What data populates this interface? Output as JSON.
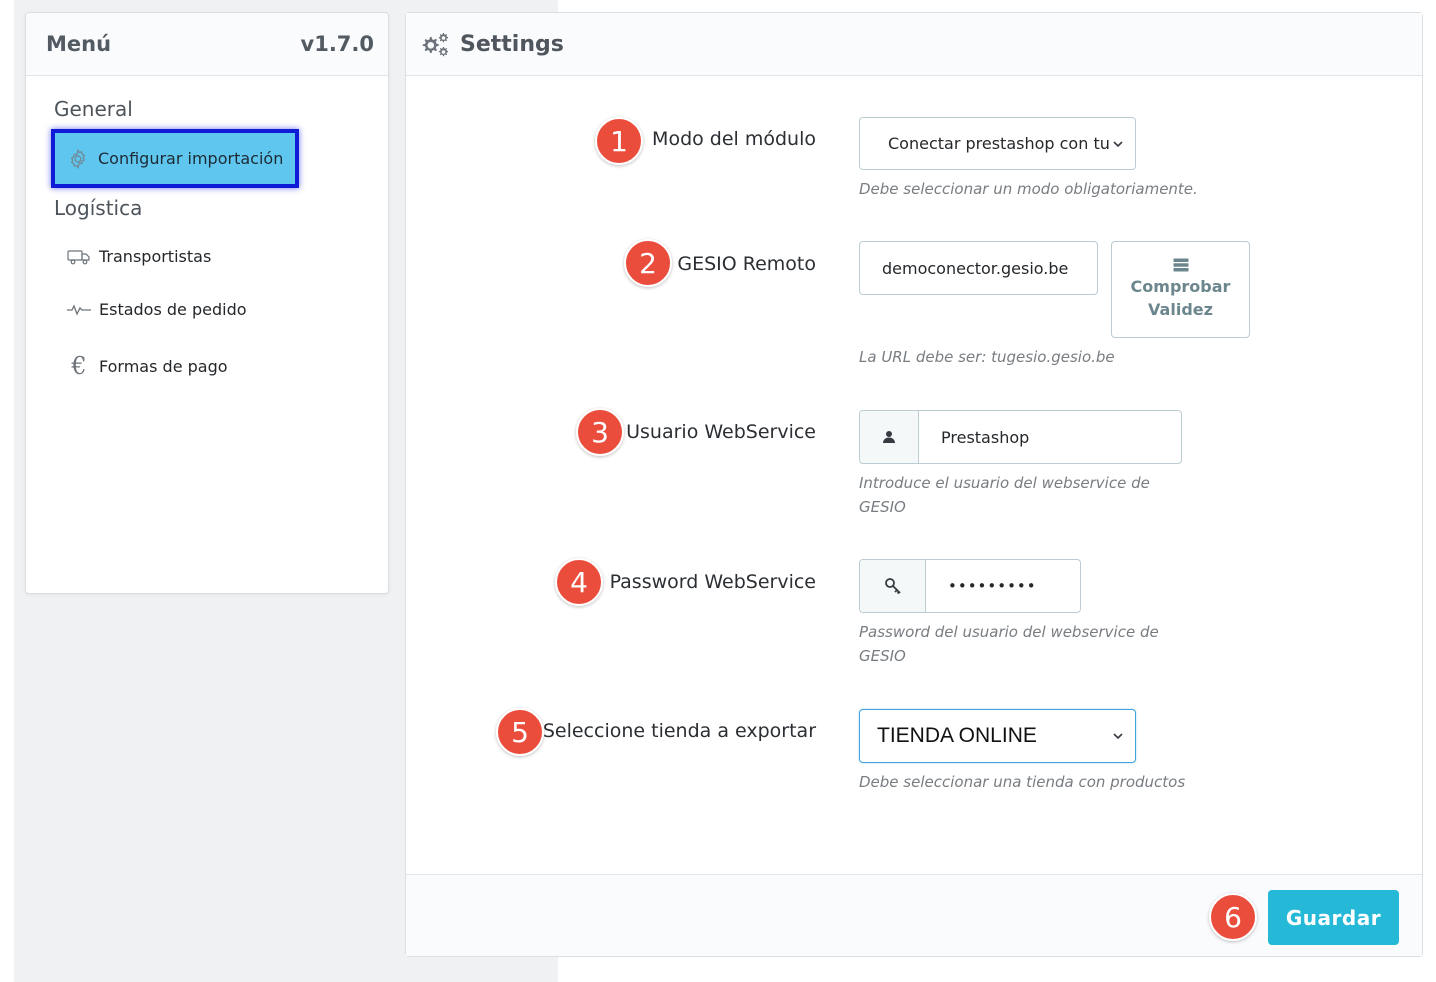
{
  "menu": {
    "title": "Menú",
    "version": "v1.7.0",
    "groups": [
      {
        "label": "General"
      },
      {
        "label": "Logística"
      }
    ],
    "items": [
      {
        "label": "Configurar importación",
        "icon": "gear-icon",
        "active": true
      },
      {
        "label": "Transportistas",
        "icon": "truck-icon"
      },
      {
        "label": "Estados de pedido",
        "icon": "pulse-icon"
      },
      {
        "label": "Formas de pago",
        "icon": "euro-icon"
      }
    ]
  },
  "settings": {
    "title": "Settings",
    "icon": "gears-icon",
    "fields": [
      {
        "step": "1",
        "label": "Modo del módulo",
        "value": "Conectar prestashop con tu GESIO",
        "help": "Debe seleccionar un modo obligatoriamente."
      },
      {
        "step": "2",
        "label": "GESIO Remoto",
        "value": "democonector.gesio.be",
        "help": "La URL debe ser: tugesio.gesio.be",
        "button": {
          "line1": "Comprobar",
          "line2": "Validez",
          "icon": "server-icon"
        }
      },
      {
        "step": "3",
        "label": "Usuario WebService",
        "value": "Prestashop",
        "icon": "user-icon",
        "help_line1": "Introduce el usuario del webservice de",
        "help_line2": "GESIO"
      },
      {
        "step": "4",
        "label": "Password WebService",
        "value": "•••••••••",
        "icon": "key-icon",
        "help_line1": "Password del usuario del webservice de",
        "help_line2": "GESIO"
      },
      {
        "step": "5",
        "label": "Seleccione tienda a exportar",
        "value": "TIENDA ONLINE",
        "help": "Debe seleccionar una tienda con productos"
      }
    ],
    "save": {
      "step": "6",
      "label": "Guardar"
    }
  },
  "colors": {
    "accent": "#25b9d7",
    "badge": "#eb4d3d",
    "active_highlight": "#5fc6ef",
    "active_border": "#0f1bd6"
  }
}
